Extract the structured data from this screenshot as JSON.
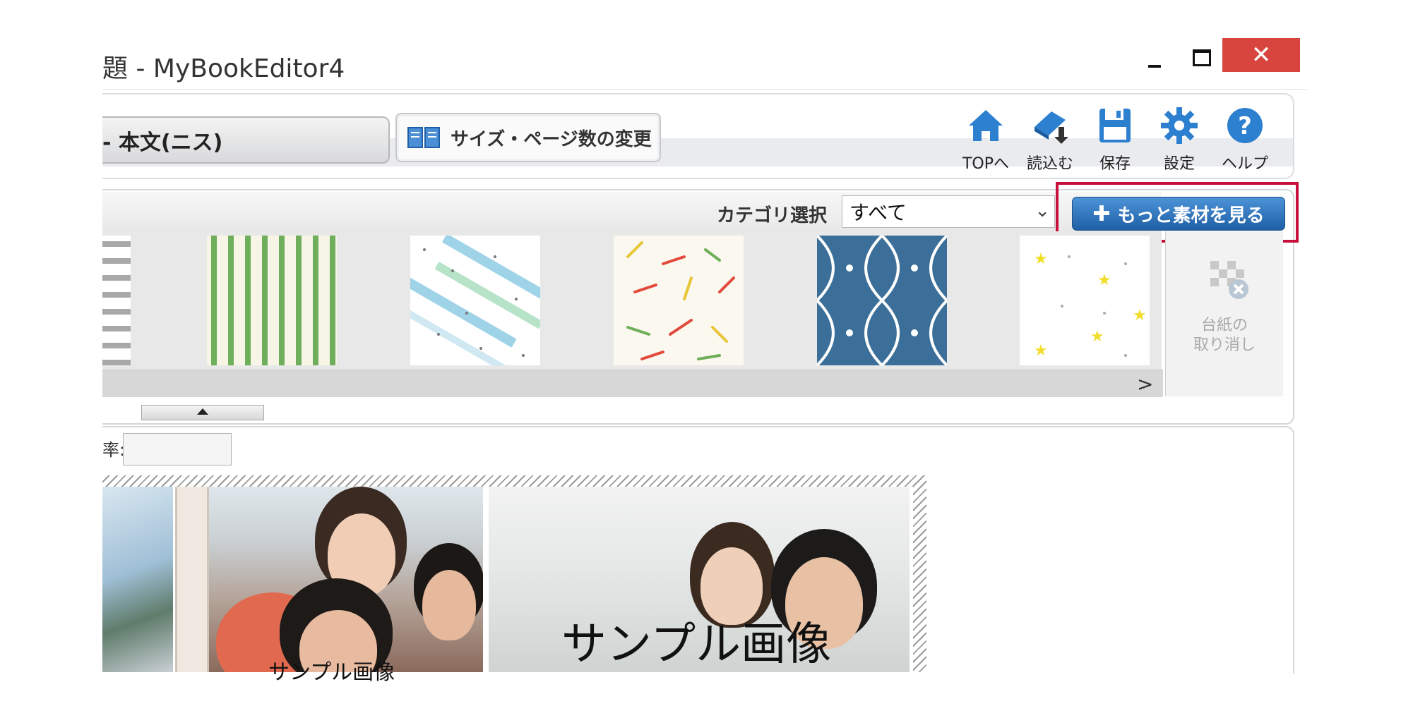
{
  "window": {
    "title": "題 - MyBookEditor4",
    "controls": {
      "minimize": "minimize",
      "maximize": "maximize",
      "close": "✕"
    }
  },
  "toolbar": {
    "page_tab_label": "- 本文(ニス)",
    "size_button_label": "サイズ・ページ数の変更",
    "tools": [
      {
        "label": "TOPへ",
        "icon": "home-icon"
      },
      {
        "label": "読込む",
        "icon": "load-book-icon"
      },
      {
        "label": "保存",
        "icon": "save-icon"
      },
      {
        "label": "設定",
        "icon": "gear-icon"
      },
      {
        "label": "ヘルプ",
        "icon": "help-icon"
      }
    ]
  },
  "materials": {
    "category_label": "カテゴリ選択",
    "category_value": "すべて",
    "more_button_label": "もっと素材を見る",
    "more_button_icon": "plus-icon",
    "patterns": [
      "horizontal-stripes",
      "green-vertical-stripes",
      "blue-dots-dashes",
      "confetti-lines",
      "blue-quatrefoil",
      "yellow-stars"
    ],
    "scroll_right": ">",
    "cancel_label_line1": "台紙の",
    "cancel_label_line2": "取り消し",
    "highlight_color": "#c8103c",
    "accent_color": "#2a6fbb"
  },
  "editor": {
    "zoom_label": "率:",
    "zoom_value": "",
    "sample_text_large": "サンプル画像",
    "sample_text_small": "サンプル画像"
  }
}
